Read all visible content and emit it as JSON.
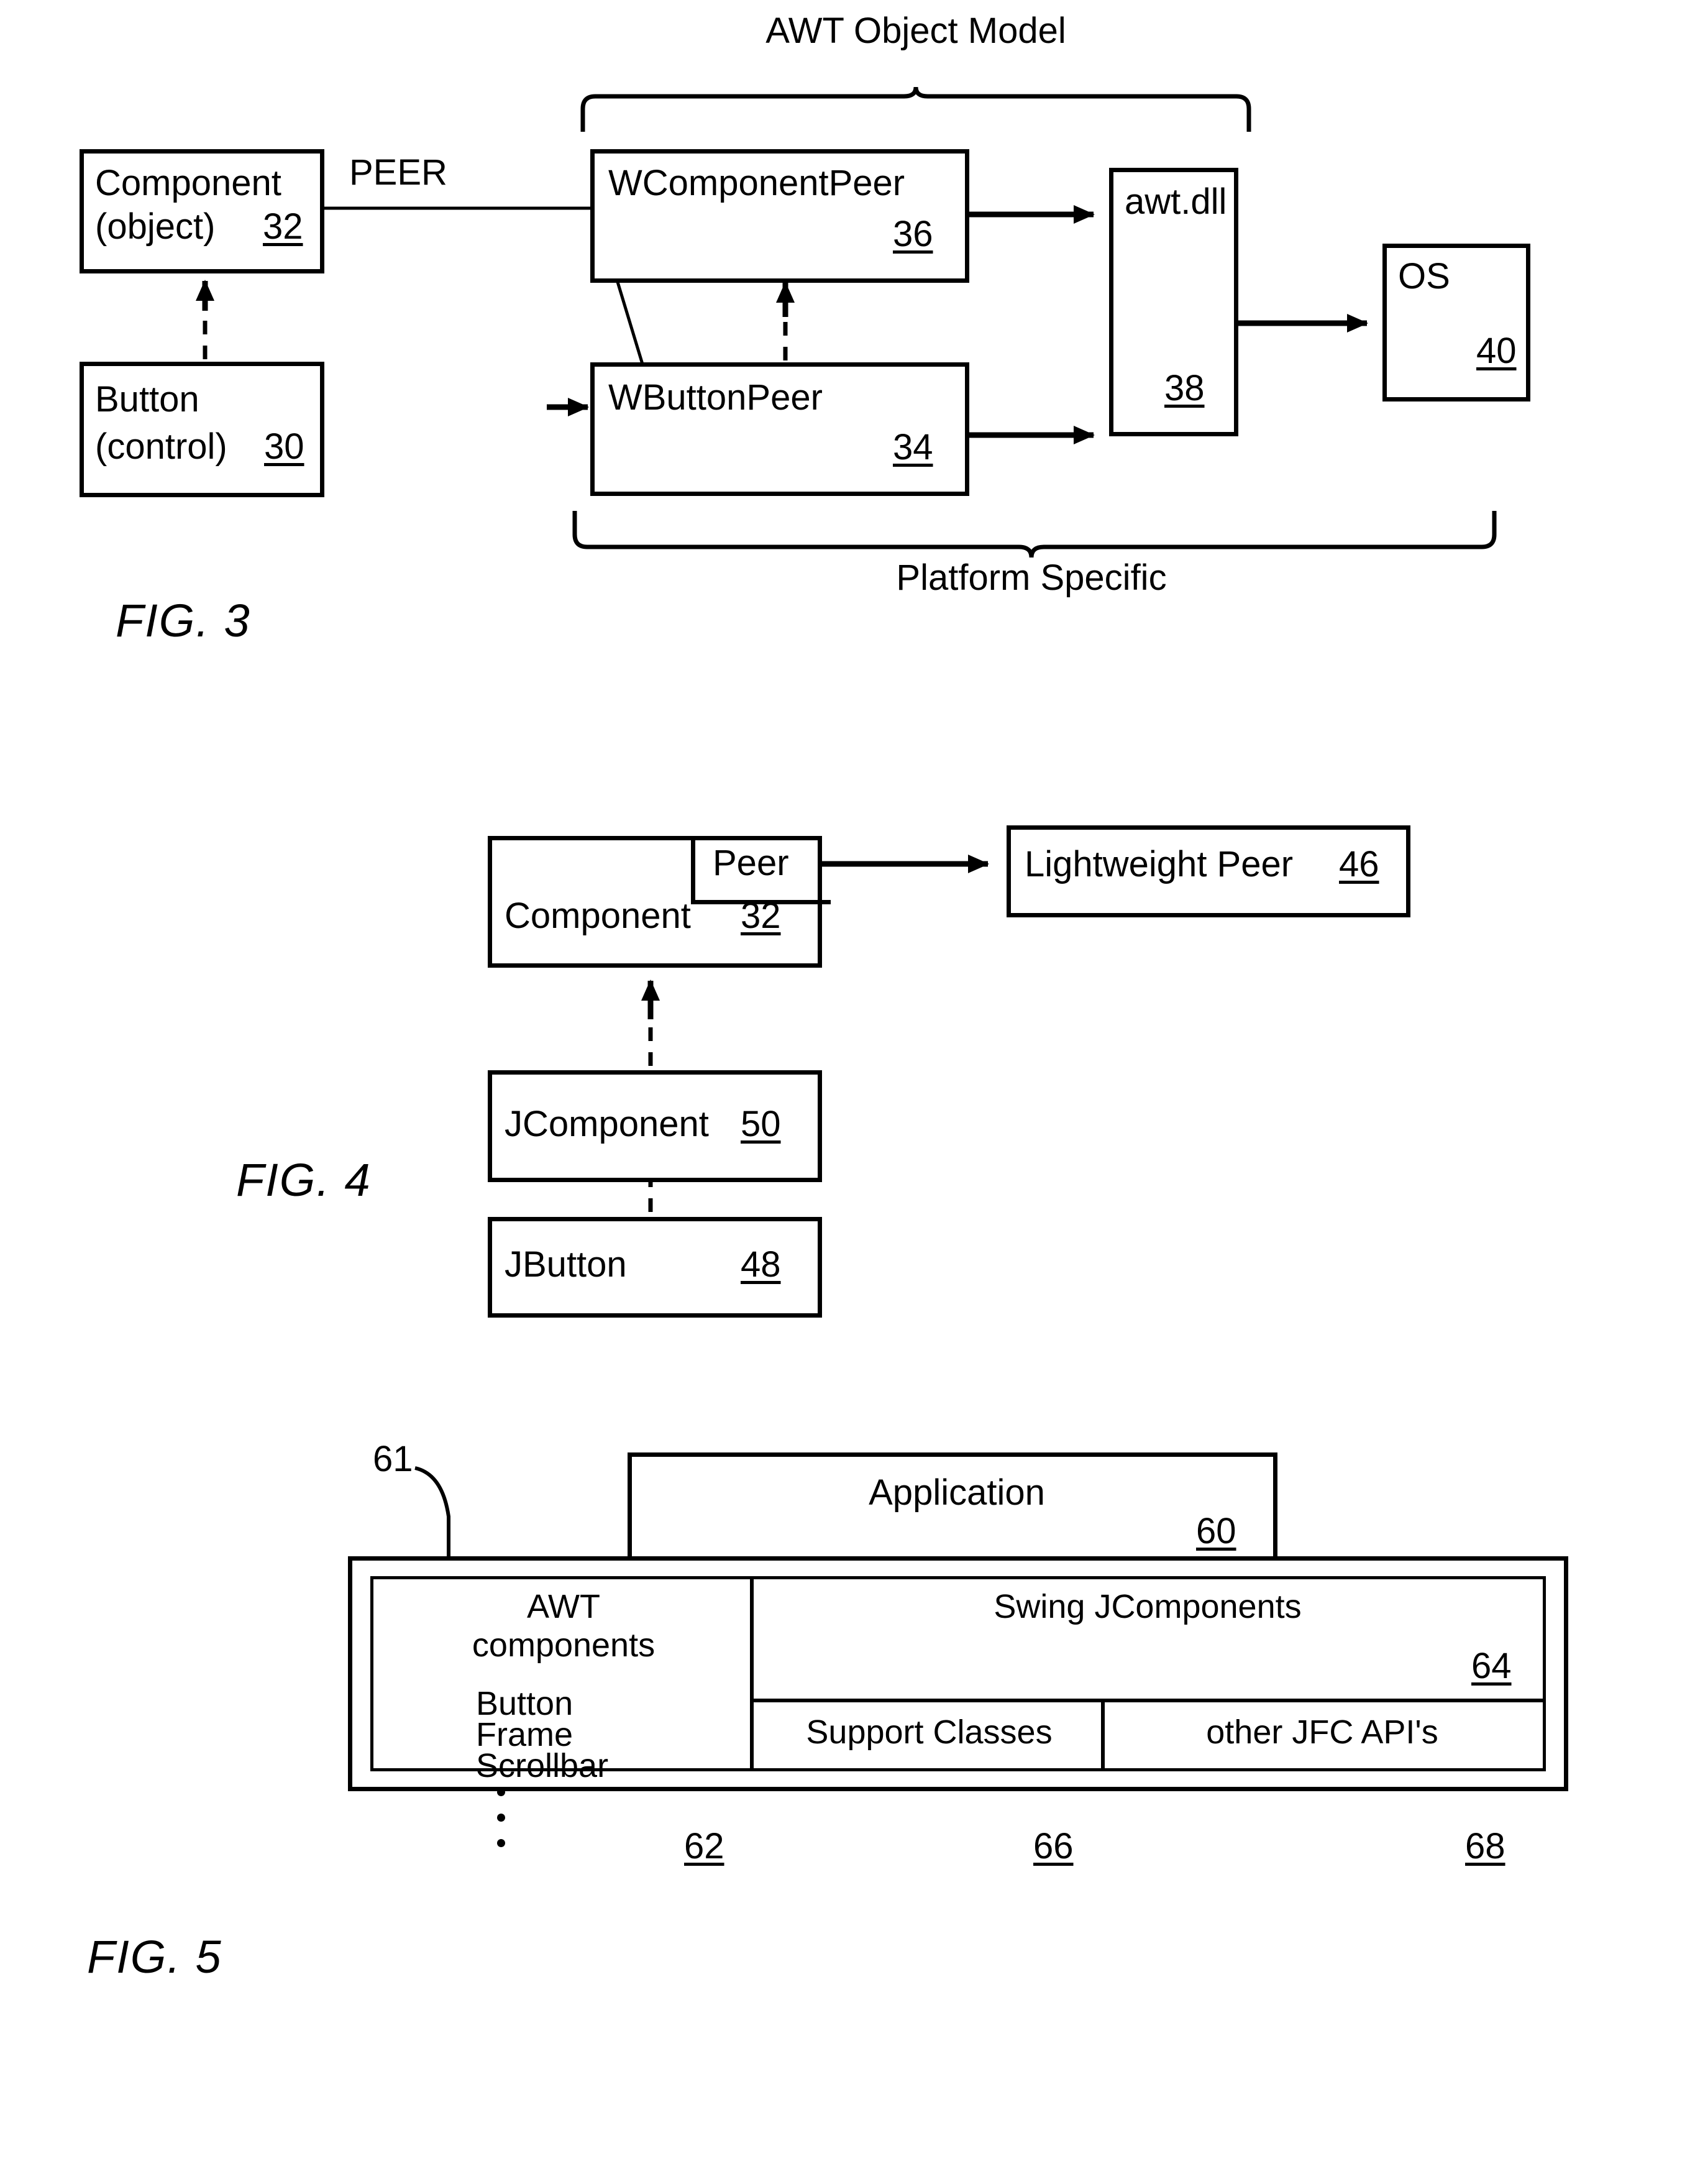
{
  "figures": [
    {
      "id": "fig3",
      "caption": "FIG. 3",
      "braces": [
        {
          "label": "AWT Object Model"
        },
        {
          "label": "Platform Specific"
        }
      ],
      "edge_labels": [
        {
          "text": "PEER"
        }
      ],
      "boxes": [
        {
          "name": "component-object",
          "line1": "Component",
          "line2": "(object)",
          "ref": "32"
        },
        {
          "name": "button-control",
          "line1": "Button",
          "line2": "(control)",
          "ref": "30"
        },
        {
          "name": "wcomponentpeer",
          "line1": "WComponentPeer",
          "line2": "",
          "ref": "36"
        },
        {
          "name": "wbuttonpeer",
          "line1": "WButtonPeer",
          "line2": "",
          "ref": "34"
        },
        {
          "name": "awtdll",
          "line1": "awt.dll",
          "line2": "",
          "ref": "38"
        },
        {
          "name": "os",
          "line1": "OS",
          "line2": "",
          "ref": "40"
        }
      ]
    },
    {
      "id": "fig4",
      "caption": "FIG. 4",
      "boxes": [
        {
          "name": "component",
          "line1": "Component",
          "ref": "32",
          "sub": "Peer"
        },
        {
          "name": "lightweightpeer",
          "line1": "Lightweight Peer",
          "ref": "46"
        },
        {
          "name": "jcomponent",
          "line1": "JComponent",
          "ref": "50"
        },
        {
          "name": "jbutton",
          "line1": "JButton",
          "ref": "48"
        }
      ]
    },
    {
      "id": "fig5",
      "caption": "FIG. 5",
      "outer_ref": "61",
      "boxes": [
        {
          "name": "application",
          "line1": "Application",
          "ref": "60"
        },
        {
          "name": "awt-components",
          "line1": "AWT",
          "line2": "components",
          "items": [
            "Button",
            "Frame",
            "Scrollbar"
          ],
          "ref": "62"
        },
        {
          "name": "swing-jcomponents",
          "line1": "Swing JComponents",
          "ref": "64"
        },
        {
          "name": "support-classes",
          "line1": "Support Classes",
          "ref": "66"
        },
        {
          "name": "other-jfc-apis",
          "line1": "other JFC API's",
          "ref": "68"
        }
      ]
    }
  ]
}
